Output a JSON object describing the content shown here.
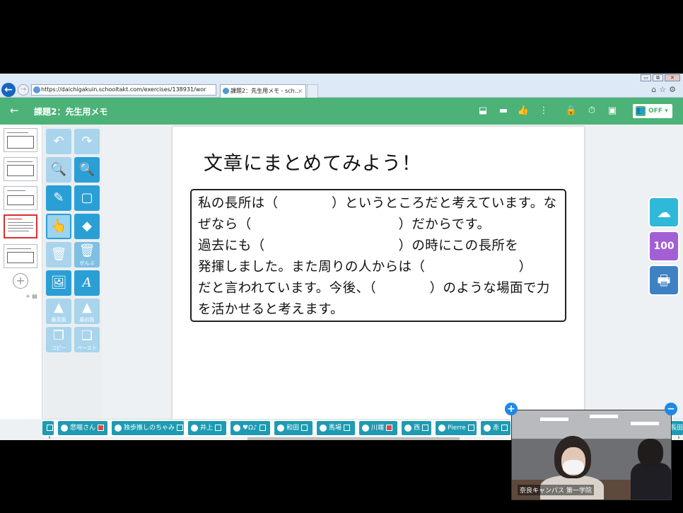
{
  "browser": {
    "url": "https://daichigakuin.schooltakt.com/exercises/138931/wor",
    "tab_title": "課題2：先生用メモ - sch...",
    "tab_close": "×",
    "back_glyph": "←",
    "forward_glyph": "→",
    "window_minimize": "▭",
    "window_restore": "⧉",
    "window_close": "✕",
    "right_icons": "⌂☆⚙"
  },
  "header": {
    "back_glyph": "←",
    "title": "課題2：先生用メモ",
    "icons": {
      "presentation": "⬓",
      "comment": "▬",
      "thumbs_up": "👍",
      "more": "⋮",
      "lock": "🔒",
      "timer": "⏱",
      "screen_share": "▣"
    },
    "share_toggle_label": "OFF ▾",
    "share_person_glyph": "👥",
    "accent_color": "#4cb278"
  },
  "sidebar": {
    "add_page_glyph": "+",
    "add_page_small": "+ ▤"
  },
  "toolbar": {
    "undo": "↶",
    "redo": "↷",
    "zoom_out": "🔍",
    "zoom_in": "🔍",
    "pen": "✎",
    "select_rect": "▢",
    "pointer": "👆",
    "eraser": "◆",
    "delete": "🗑",
    "delete_all_glyph": "🗑",
    "delete_all_label": "ぜんぶ",
    "image": "🖼",
    "text": "A",
    "to_back_label": "最背面",
    "to_front_label": "最前面",
    "layer_glyph": "▲",
    "copy_label": "コピー",
    "paste_label": "ペースト",
    "copy_glyph": "❐",
    "paste_glyph": "❏"
  },
  "canvas": {
    "heading": "文章にまとめてみよう！",
    "lines": [
      "私の長所は（　　　　）というところだと考えています。な",
      "ぜなら（　　　　　　　　　　　）だからです。",
      "過去にも（　　　　　　　　　　）の時にこの長所を",
      "発揮しました。また周りの人からは（　　　　　　　）",
      "だと言われています。今後、（　　　　）のような場面で力",
      "を活かせると考えます。"
    ]
  },
  "side_tools": {
    "ai_glyph": "☁",
    "score_label": "100",
    "print_glyph": "🖶"
  },
  "students": [
    {
      "name": "",
      "red": false
    },
    {
      "name": "悲喵さん",
      "red": true
    },
    {
      "name": "独歩推しのちゃみ",
      "red": false
    },
    {
      "name": "井上",
      "red": false
    },
    {
      "name": "♥Ω♪",
      "red": false
    },
    {
      "name": "和田",
      "red": false
    },
    {
      "name": "馬場",
      "red": false
    },
    {
      "name": "川端",
      "red": true
    },
    {
      "name": "西",
      "red": false
    },
    {
      "name": "Pierre",
      "red": false
    },
    {
      "name": "赤",
      "red": false
    }
  ],
  "student_bar": {
    "scroll_left": "‹",
    "edge_label": "長田",
    "edge_arrow": "›"
  },
  "webcam": {
    "label": "奈良キャンパス 第一学院",
    "plus_glyph": "+",
    "minus_glyph": "−"
  }
}
